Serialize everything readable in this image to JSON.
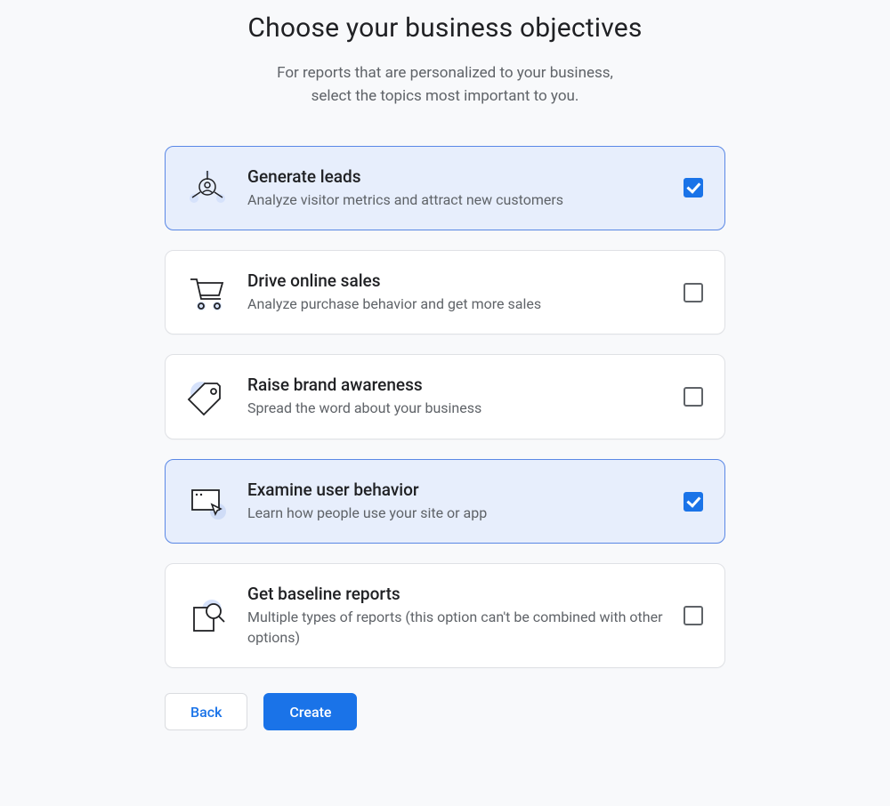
{
  "header": {
    "title": "Choose your business objectives",
    "subtitle_line1": "For reports that are personalized to your business,",
    "subtitle_line2": "select the topics most important to you."
  },
  "options": [
    {
      "id": "generate-leads",
      "title": "Generate leads",
      "description": "Analyze visitor metrics and attract new customers",
      "selected": true,
      "icon": "target-person-icon"
    },
    {
      "id": "drive-online-sales",
      "title": "Drive online sales",
      "description": "Analyze purchase behavior and get more sales",
      "selected": false,
      "icon": "shopping-cart-icon"
    },
    {
      "id": "raise-brand-awareness",
      "title": "Raise brand awareness",
      "description": "Spread the word about your business",
      "selected": false,
      "icon": "price-tag-icon"
    },
    {
      "id": "examine-user-behavior",
      "title": "Examine user behavior",
      "description": "Learn how people use your site or app",
      "selected": true,
      "icon": "cursor-window-icon"
    },
    {
      "id": "get-baseline-reports",
      "title": "Get baseline reports",
      "description": "Multiple types of reports (this option can't be combined with other options)",
      "selected": false,
      "icon": "report-magnifier-icon"
    }
  ],
  "footer": {
    "back_label": "Back",
    "create_label": "Create"
  },
  "colors": {
    "accent": "#1a73e8",
    "selected_bg": "#e7eefc",
    "selected_border": "#5a88e6"
  }
}
